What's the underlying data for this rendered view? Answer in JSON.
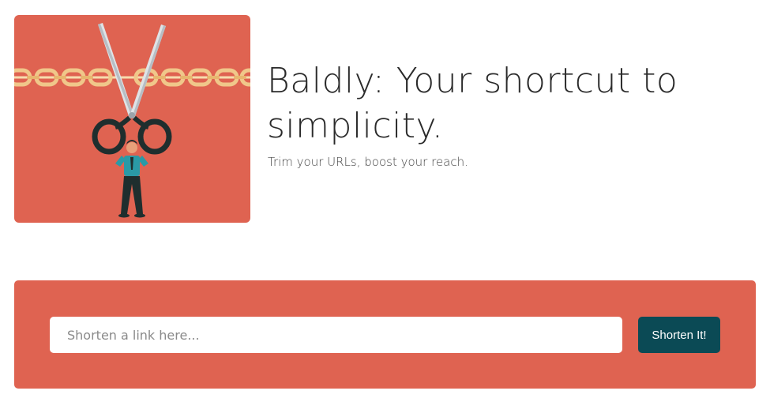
{
  "hero": {
    "title": "Baldly: Your shortcut to simplicity.",
    "subtitle": "Trim your URLs, boost your reach.",
    "illustration": "scissors-cutting-chain-illustration"
  },
  "shortener": {
    "placeholder": "Shorten a link here...",
    "value": "",
    "button_label": "Shorten It!"
  },
  "colors": {
    "accent": "#df6351",
    "button": "#0b4a55",
    "chain": "#f0c78a"
  }
}
